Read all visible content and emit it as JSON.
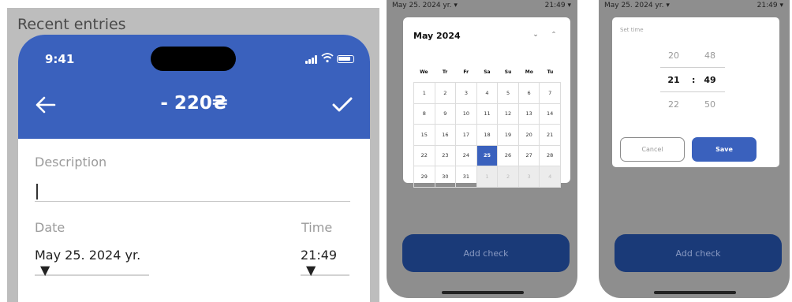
{
  "panel1": {
    "section_title": "Recent entries",
    "status_time": "9:41",
    "amount": "- 220₴",
    "description": {
      "label": "Description",
      "value": ""
    },
    "date": {
      "label": "Date",
      "value": "May 25. 2024 yr."
    },
    "time": {
      "label": "Time",
      "value": "21:49"
    }
  },
  "panel2": {
    "status_date": "May 25. 2024 yr. ▾",
    "status_time": "21:49 ▾",
    "calendar": {
      "month_title": "May 2024",
      "weekdays": [
        "We",
        "Tr",
        "Fr",
        "Sa",
        "Su",
        "Mo",
        "Tu"
      ],
      "rows": [
        [
          "1",
          "2",
          "3",
          "4",
          "5",
          "6",
          "7"
        ],
        [
          "8",
          "9",
          "10",
          "11",
          "12",
          "13",
          "14"
        ],
        [
          "15",
          "16",
          "17",
          "18",
          "19",
          "20",
          "21"
        ],
        [
          "22",
          "23",
          "24",
          "25",
          "26",
          "27",
          "28"
        ],
        [
          "29",
          "30",
          "31",
          "1",
          "2",
          "3",
          "4"
        ]
      ],
      "selected_day": "25"
    },
    "add_check_label": "Add check"
  },
  "panel3": {
    "status_date": "May 25. 2024 yr. ▾",
    "status_time": "21:49 ▾",
    "time_picker": {
      "label": "Set time",
      "hours_above": "20",
      "hours_current": "21",
      "hours_below": "22",
      "minutes_above": "48",
      "minutes_current": "49",
      "minutes_below": "50",
      "separator": ":",
      "cancel_label": "Cancel",
      "save_label": "Save"
    },
    "add_check_label": "Add check"
  },
  "colors": {
    "brand_blue": "#3a61bd",
    "button_navy": "#1a3a78",
    "overlay_grey": "#8e8e8e"
  },
  "icons": [
    "back-arrow-icon",
    "checkmark-icon",
    "signal-icon",
    "wifi-icon",
    "battery-icon",
    "dropdown-triangle-icon",
    "chevron-down-icon",
    "chevron-up-icon"
  ]
}
